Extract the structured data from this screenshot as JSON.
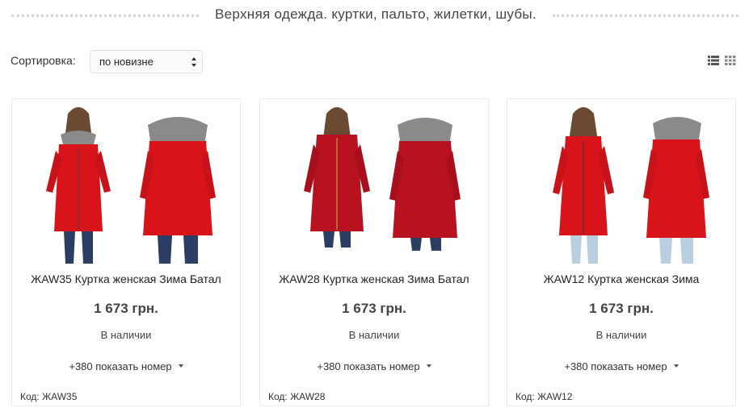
{
  "page": {
    "title": "Верхняя одежда. куртки, пальто, жилетки, шубы."
  },
  "sort": {
    "label": "Сортировка:",
    "selected": "по новизне"
  },
  "view": {
    "list_icon": "list-view-icon",
    "grid_icon": "grid-view-icon"
  },
  "colors": {
    "jacket_red": "#d8141a",
    "jacket_crimson": "#b8111f",
    "jeans": "#2b3d63",
    "light_jeans": "#b9cfe0",
    "fur": "#8a8a8a"
  },
  "products": [
    {
      "title": "ЖAW35 Куртка женская Зима Батал",
      "price": "1 673 грн.",
      "stock": "В наличии",
      "phone": "+380 показать номер",
      "code": "Код: ЖAW35"
    },
    {
      "title": "ЖAW28 Куртка женская Зима Батал",
      "price": "1 673 грн.",
      "stock": "В наличии",
      "phone": "+380 показать номер",
      "code": "Код: ЖAW28"
    },
    {
      "title": "ЖAW12 Куртка женская Зима",
      "price": "1 673 грн.",
      "stock": "В наличии",
      "phone": "+380 показать номер",
      "code": "Код: ЖAW12"
    }
  ]
}
